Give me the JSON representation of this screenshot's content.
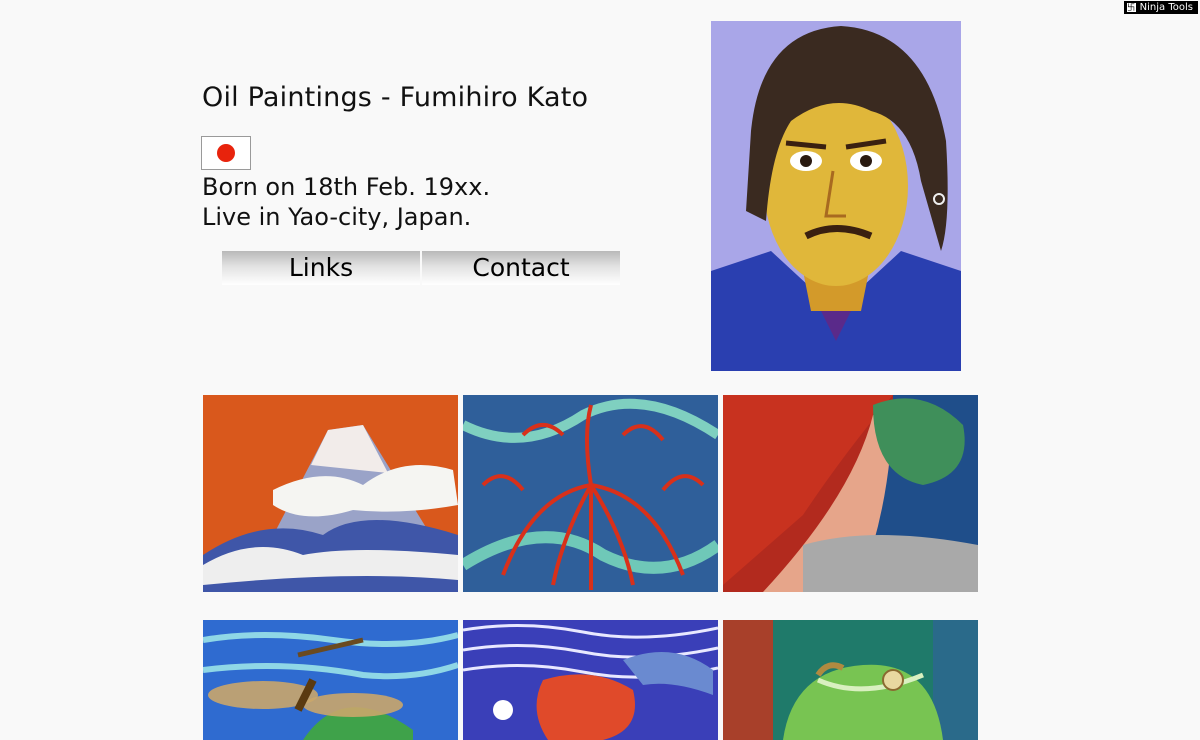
{
  "toolbar": {
    "label": "Ninja Tools"
  },
  "header": {
    "title": "Oil Paintings - Fumihiro Kato",
    "flag": "japan-flag-icon"
  },
  "bio": {
    "line1": "Born on 18th Feb. 19xx.",
    "line2": "Live in Yao-city, Japan."
  },
  "nav": [
    {
      "label": "Links"
    },
    {
      "label": "Contact"
    }
  ],
  "gallery": [
    {
      "subject": "Mount Fuji"
    },
    {
      "subject": "Red spider lily"
    },
    {
      "subject": "Red forest path"
    },
    {
      "subject": "Dragonfly"
    },
    {
      "subject": "Goldfish"
    },
    {
      "subject": "Cabbage with snail"
    }
  ]
}
